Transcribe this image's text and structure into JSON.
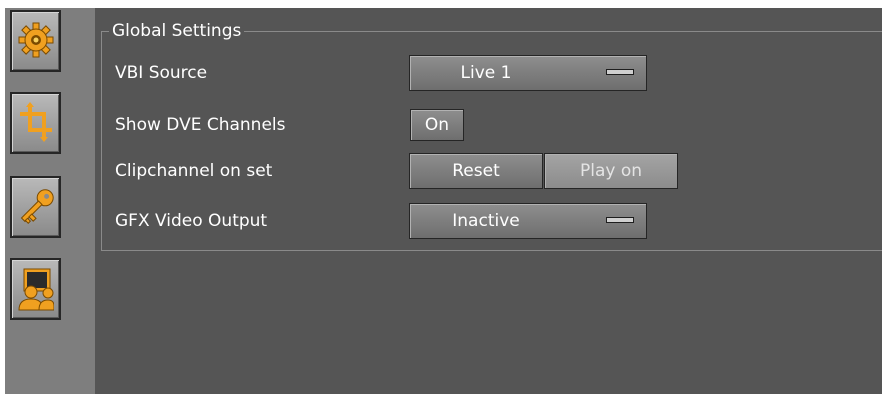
{
  "sidebar": {
    "items": [
      {
        "icon": "gear-icon"
      },
      {
        "icon": "crop-icon"
      },
      {
        "icon": "key-icon"
      },
      {
        "icon": "users-icon"
      }
    ]
  },
  "global_settings": {
    "title": "Global Settings",
    "vbi_source": {
      "label": "VBI Source",
      "value": "Live 1"
    },
    "show_dve_channels": {
      "label": "Show DVE Channels",
      "value": "On"
    },
    "clipchannel_on_set": {
      "label": "Clipchannel on set",
      "options": [
        "Reset",
        "Play on"
      ]
    },
    "gfx_video_output": {
      "label": "GFX Video Output",
      "value": "Inactive"
    }
  },
  "colors": {
    "panel_bg": "#555555",
    "sidebar_bg": "#7e7e7e",
    "icon_accent": "#f0a020"
  }
}
